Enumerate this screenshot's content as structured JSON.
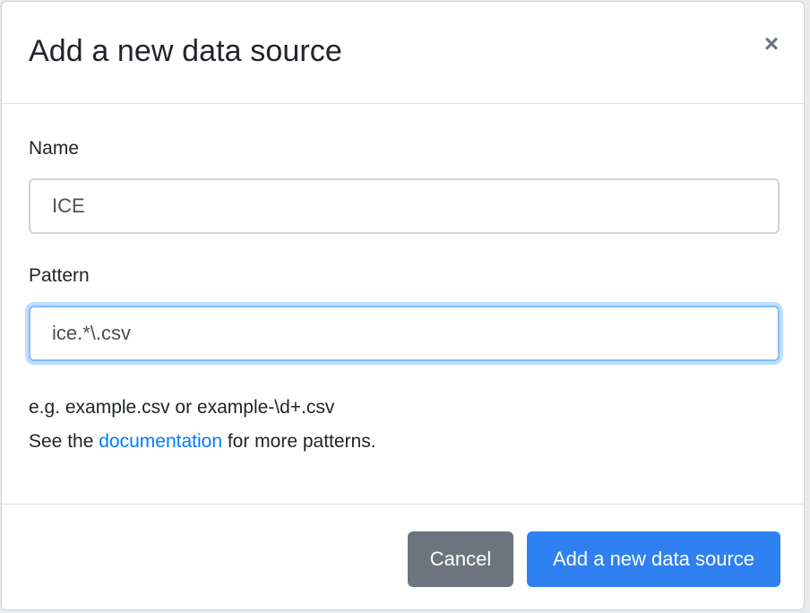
{
  "modal": {
    "title": "Add a new data source",
    "close_glyph": "×",
    "close_icon": "close-icon"
  },
  "form": {
    "name": {
      "label": "Name",
      "value": "ICE"
    },
    "pattern": {
      "label": "Pattern",
      "value": "ice.*\\.csv"
    },
    "help": {
      "line1": "e.g. example.csv or example-\\d+.csv",
      "line2_prefix": "See the ",
      "link_text": "documentation",
      "line2_suffix": " for more patterns."
    }
  },
  "footer": {
    "cancel_label": "Cancel",
    "submit_label": "Add a new data source"
  },
  "colors": {
    "primary": "#2f80f1",
    "secondary": "#6c757d",
    "link": "#007bff",
    "focus_border": "#80bdff"
  }
}
